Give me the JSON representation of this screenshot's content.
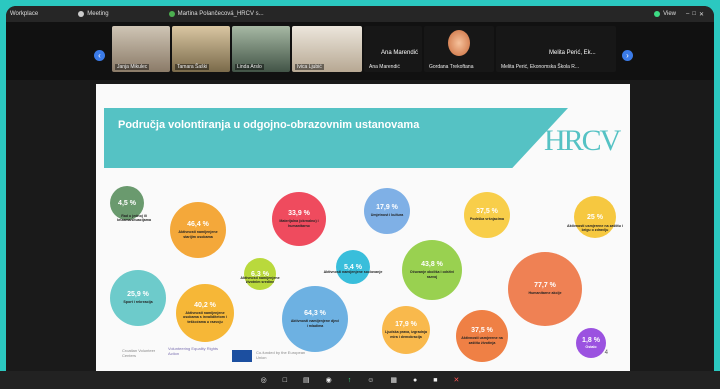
{
  "titlebar": {
    "app": "Workplace",
    "tab1": "Meeting",
    "tab2": "Martina Polančecová_HRCV s...",
    "status": "View"
  },
  "participants": [
    {
      "name": "Janja Mikulec"
    },
    {
      "name": "Tamara Šaški"
    },
    {
      "name": "Linda Arslo"
    },
    {
      "name": "Ana Marendić",
      "caption": "Ana Marendić"
    },
    {
      "name": "Gordana Trekoftana"
    },
    {
      "name": "Melita Perić, Ekonomska Škola R...",
      "caption": "Melita Perić, Ek..."
    }
  ],
  "slide": {
    "title": "Područja volontiranja u odgojno-obrazovnim ustanovama",
    "logo": "HRCV",
    "page": "4",
    "footer": {
      "left": "Croatian Volunteer Centers",
      "middle": "Volunteering Equality Rights Action",
      "eu": "Co-funded by the European Union"
    },
    "bubbles": [
      {
        "pct": "4,5 %",
        "label": "Rad u jednoj ili krizama/situacijama",
        "color": "#6a9a6e"
      },
      {
        "pct": "46,4 %",
        "label": "Aktivnosti namijenjene starijim osobama",
        "color": "#f4a83a"
      },
      {
        "pct": "33,9 %",
        "label": "Materijalna (okrnalno) i humanitarno",
        "color": "#ef4b5e"
      },
      {
        "pct": "17,9 %",
        "label": "Umjetnost i kultura",
        "color": "#7fb0e6"
      },
      {
        "pct": "37,5 %",
        "label": "Podrška vršnjacima",
        "color": "#f8ce4a"
      },
      {
        "pct": "25 %",
        "label": "Aktivnosti usmjerene na zaštitu i brigu o zdravlju",
        "color": "#f6c840"
      },
      {
        "pct": "6,3 %",
        "label": "Aktivnosti namijenjene životnim sredine",
        "color": "#b9d93c"
      },
      {
        "pct": "5,4 %",
        "label": "Aktivnosti namijenjene sociovanje",
        "color": "#39bedb"
      },
      {
        "pct": "43,8 %",
        "label": "Očuvanje okoliša i održivi razvoj",
        "color": "#99d150"
      },
      {
        "pct": "77,7 %",
        "label": "Humanitarne akcije",
        "color": "#ef8154"
      },
      {
        "pct": "25,9 %",
        "label": "Sport i rekreacija",
        "color": "#6dcbcb"
      },
      {
        "pct": "40,2 %",
        "label": "Aktivnosti namijenjene osobama s invaliditetom i teškoćama u razvoju",
        "color": "#f6b737"
      },
      {
        "pct": "64,3 %",
        "label": "Aktivnosti namijenjene djeci i mladima",
        "color": "#6db1e2"
      },
      {
        "pct": "17,9 %",
        "label": "Ljudska prava, izgradnja mira i demokracija",
        "color": "#f9b94c"
      },
      {
        "pct": "37,5 %",
        "label": "Aktivnosti usmjerene na zaštitu životinja",
        "color": "#ef8045"
      },
      {
        "pct": "1,8 %",
        "label": "Ostalo",
        "color": "#9b52e0"
      }
    ]
  },
  "toolbar": {
    "items": [
      "◎",
      "□",
      "▤",
      "◉",
      "↑",
      "☺",
      "▦",
      "●",
      "■",
      "✕"
    ]
  }
}
